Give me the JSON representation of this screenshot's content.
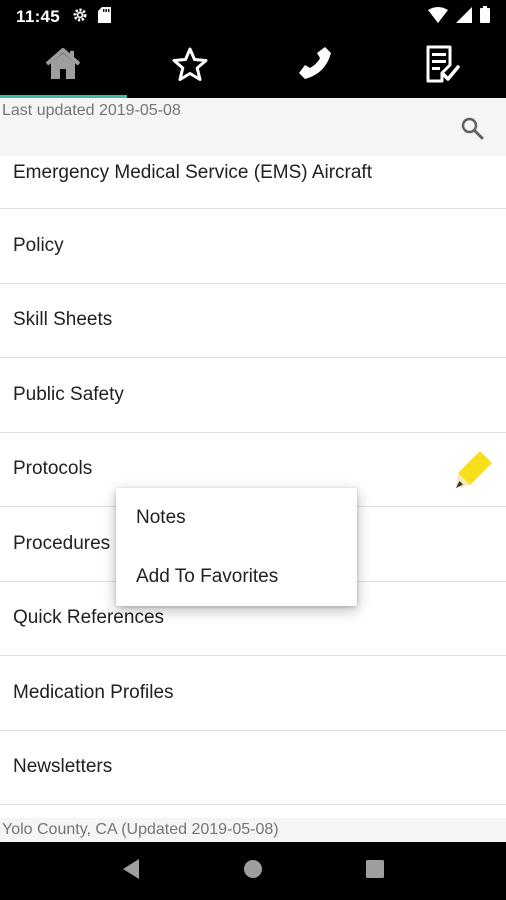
{
  "status_bar": {
    "time": "11:45",
    "left_icons": [
      "gear-icon",
      "sd-card-icon"
    ],
    "right_icons": [
      "wifi-icon",
      "cell-signal-icon",
      "battery-icon"
    ]
  },
  "nav_tabs": [
    {
      "icon": "home-icon",
      "active": true
    },
    {
      "icon": "star-icon",
      "active": false
    },
    {
      "icon": "phone-icon",
      "active": false
    },
    {
      "icon": "checklist-icon",
      "active": false
    }
  ],
  "header": {
    "last_updated": "Last updated 2019-05-08",
    "search_icon": "search-icon"
  },
  "list": {
    "items": [
      {
        "label": "Emergency Medical Service (EMS) Aircraft"
      },
      {
        "label": "Policy"
      },
      {
        "label": "Skill Sheets"
      },
      {
        "label": "Public Safety"
      },
      {
        "label": "Protocols",
        "icon": "pencil-icon"
      },
      {
        "label": "Procedures"
      },
      {
        "label": "Quick References"
      },
      {
        "label": "Medication Profiles"
      },
      {
        "label": "Newsletters"
      }
    ]
  },
  "popup_menu": {
    "items": [
      {
        "label": "Notes"
      },
      {
        "label": "Add To Favorites"
      }
    ]
  },
  "footer": {
    "text": "Yolo County, CA (Updated 2019-05-08)"
  },
  "system_nav": [
    "back-icon",
    "home-circle-icon",
    "recents-icon"
  ],
  "colors": {
    "accent": "#3fb99f",
    "pencil": "#f7e01b",
    "bar_bg": "#000000"
  }
}
